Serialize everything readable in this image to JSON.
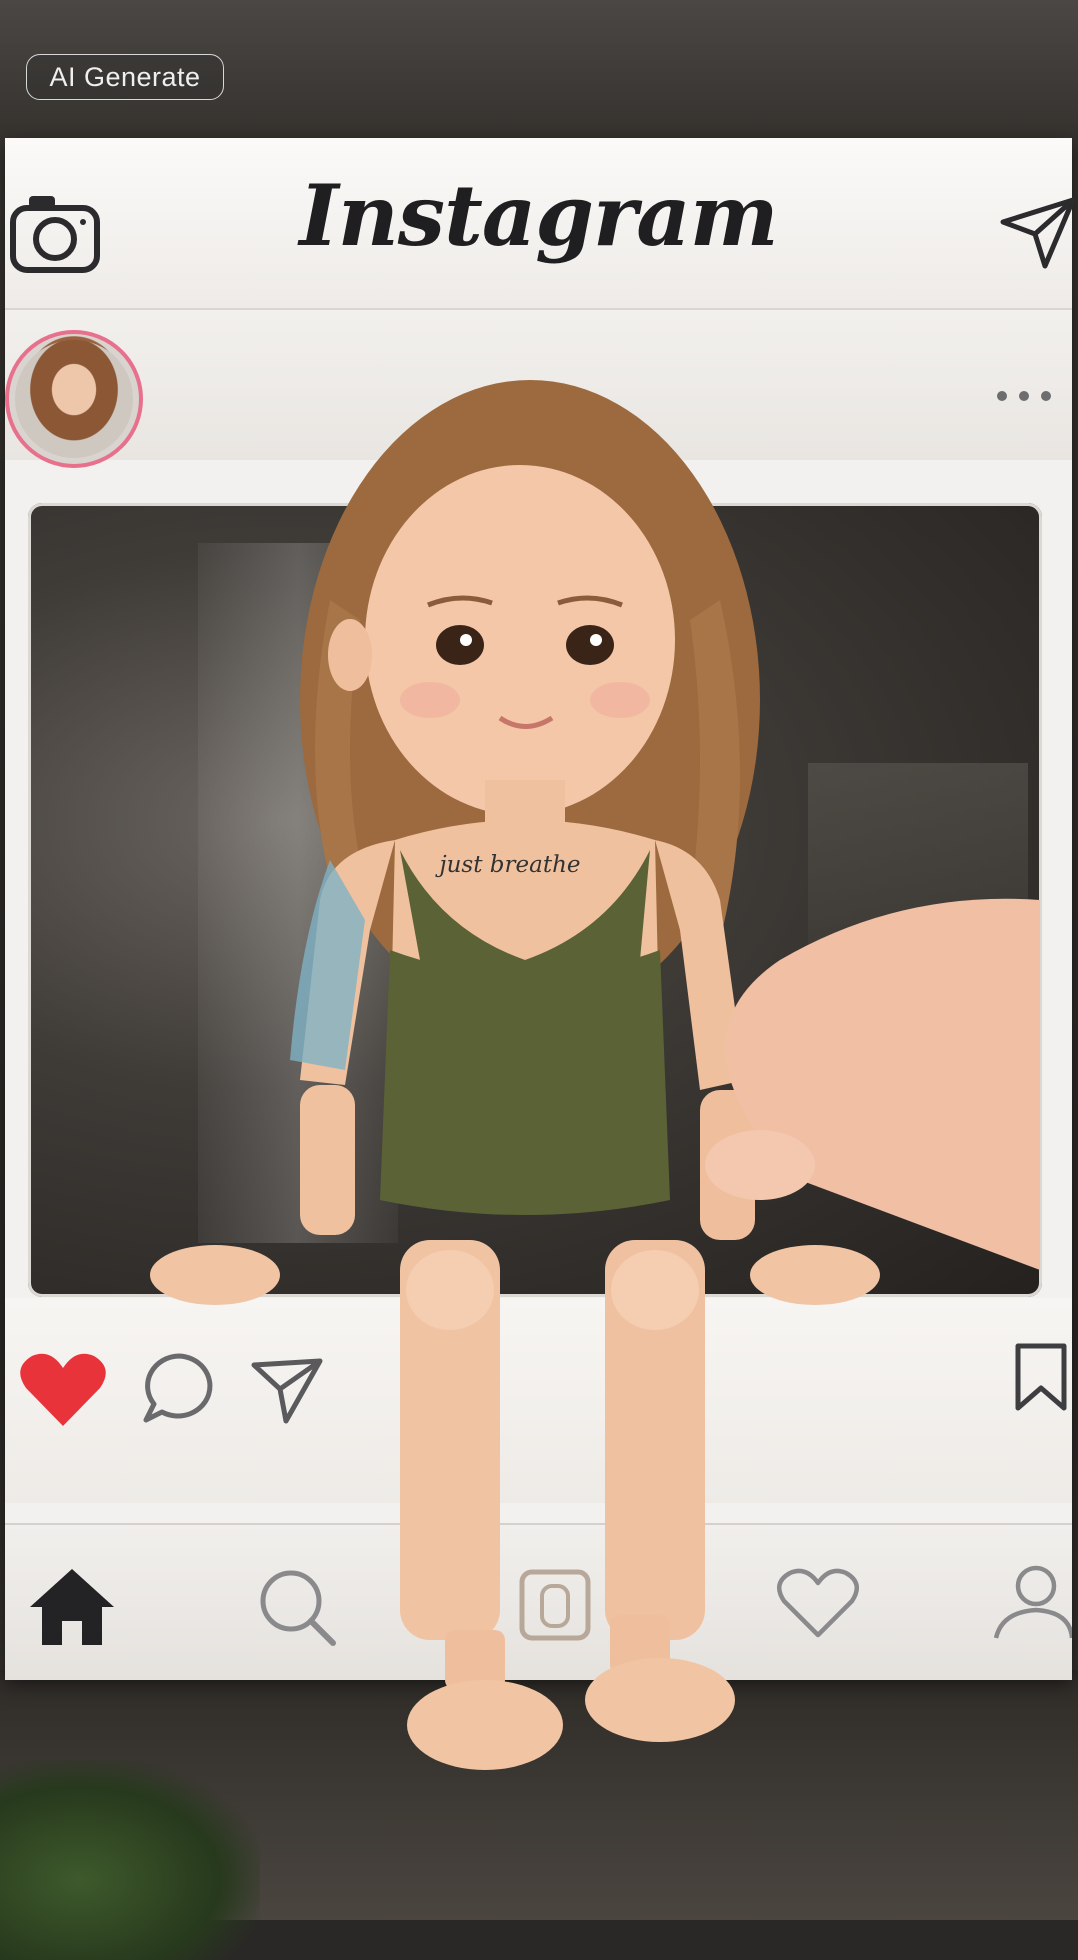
{
  "badge": {
    "label": "AI Generate"
  },
  "header": {
    "brand": "Instagram"
  },
  "post": {
    "tattoo_text": "just breathe",
    "liked": true,
    "like_color": "#e8333b",
    "story_ring_color": "#e7708d"
  },
  "icons": {
    "camera": "camera-icon",
    "direct": "paper-plane-icon",
    "more": "more-dots-icon",
    "like": "heart-filled-icon",
    "comment": "comment-bubble-icon",
    "share": "paper-plane-icon",
    "save": "bookmark-icon",
    "nav": [
      "home-icon",
      "search-icon",
      "reels-icon",
      "heart-outline-icon",
      "profile-icon"
    ]
  }
}
